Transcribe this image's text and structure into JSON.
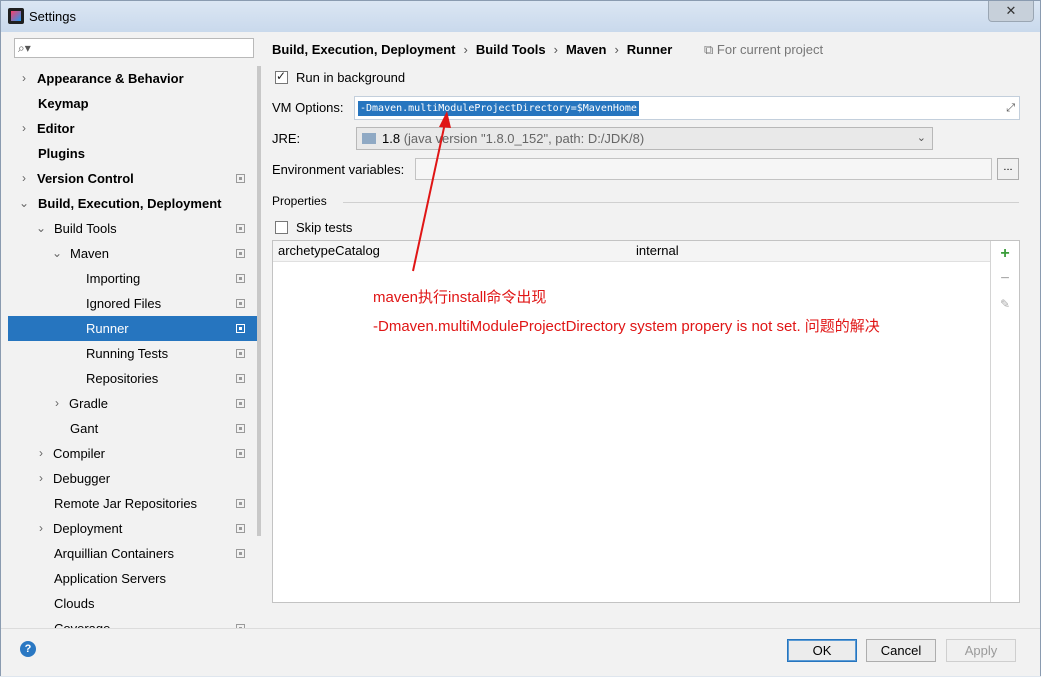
{
  "window": {
    "title": "Settings",
    "close_label": "✕"
  },
  "search": {
    "placeholder": ""
  },
  "sidebar": {
    "items": [
      {
        "label": "Appearance & Behavior"
      },
      {
        "label": "Keymap"
      },
      {
        "label": "Editor"
      },
      {
        "label": "Plugins"
      },
      {
        "label": "Version Control"
      },
      {
        "label": "Build, Execution, Deployment"
      },
      {
        "label": "Build Tools"
      },
      {
        "label": "Maven"
      },
      {
        "label": "Importing"
      },
      {
        "label": "Ignored Files"
      },
      {
        "label": "Runner"
      },
      {
        "label": "Running Tests"
      },
      {
        "label": "Repositories"
      },
      {
        "label": "Gradle"
      },
      {
        "label": "Gant"
      },
      {
        "label": "Compiler"
      },
      {
        "label": "Debugger"
      },
      {
        "label": "Remote Jar Repositories"
      },
      {
        "label": "Deployment"
      },
      {
        "label": "Arquillian Containers"
      },
      {
        "label": "Application Servers"
      },
      {
        "label": "Clouds"
      },
      {
        "label": "Coverage"
      }
    ]
  },
  "breadcrumb": {
    "parts": [
      "Build, Execution, Deployment",
      "Build Tools",
      "Maven",
      "Runner"
    ],
    "scope": "For current project"
  },
  "form": {
    "run_in_background": "Run in background",
    "vm_options_label": "VM Options:",
    "vm_options_value": "-Dmaven.multiModuleProjectDirectory=$MavenHome",
    "jre_label": "JRE:",
    "jre_version": "1.8",
    "jre_detail": "(java version \"1.8.0_152\", path: D:/JDK/8)",
    "env_label": "Environment variables:",
    "env_button": "...",
    "properties_label": "Properties",
    "skip_tests": "Skip tests"
  },
  "properties_table": {
    "rows": [
      {
        "key": "archetypeCatalog",
        "value": "internal"
      }
    ]
  },
  "annotation": {
    "line1": "maven执行install命令出现",
    "line2": "-Dmaven.multiModuleProjectDirectory  system  propery  is  not  set. 问题的解决"
  },
  "buttons": {
    "ok": "OK",
    "cancel": "Cancel",
    "apply": "Apply"
  },
  "colors": {
    "selection": "#2675bf",
    "annotation": "#e01515"
  }
}
